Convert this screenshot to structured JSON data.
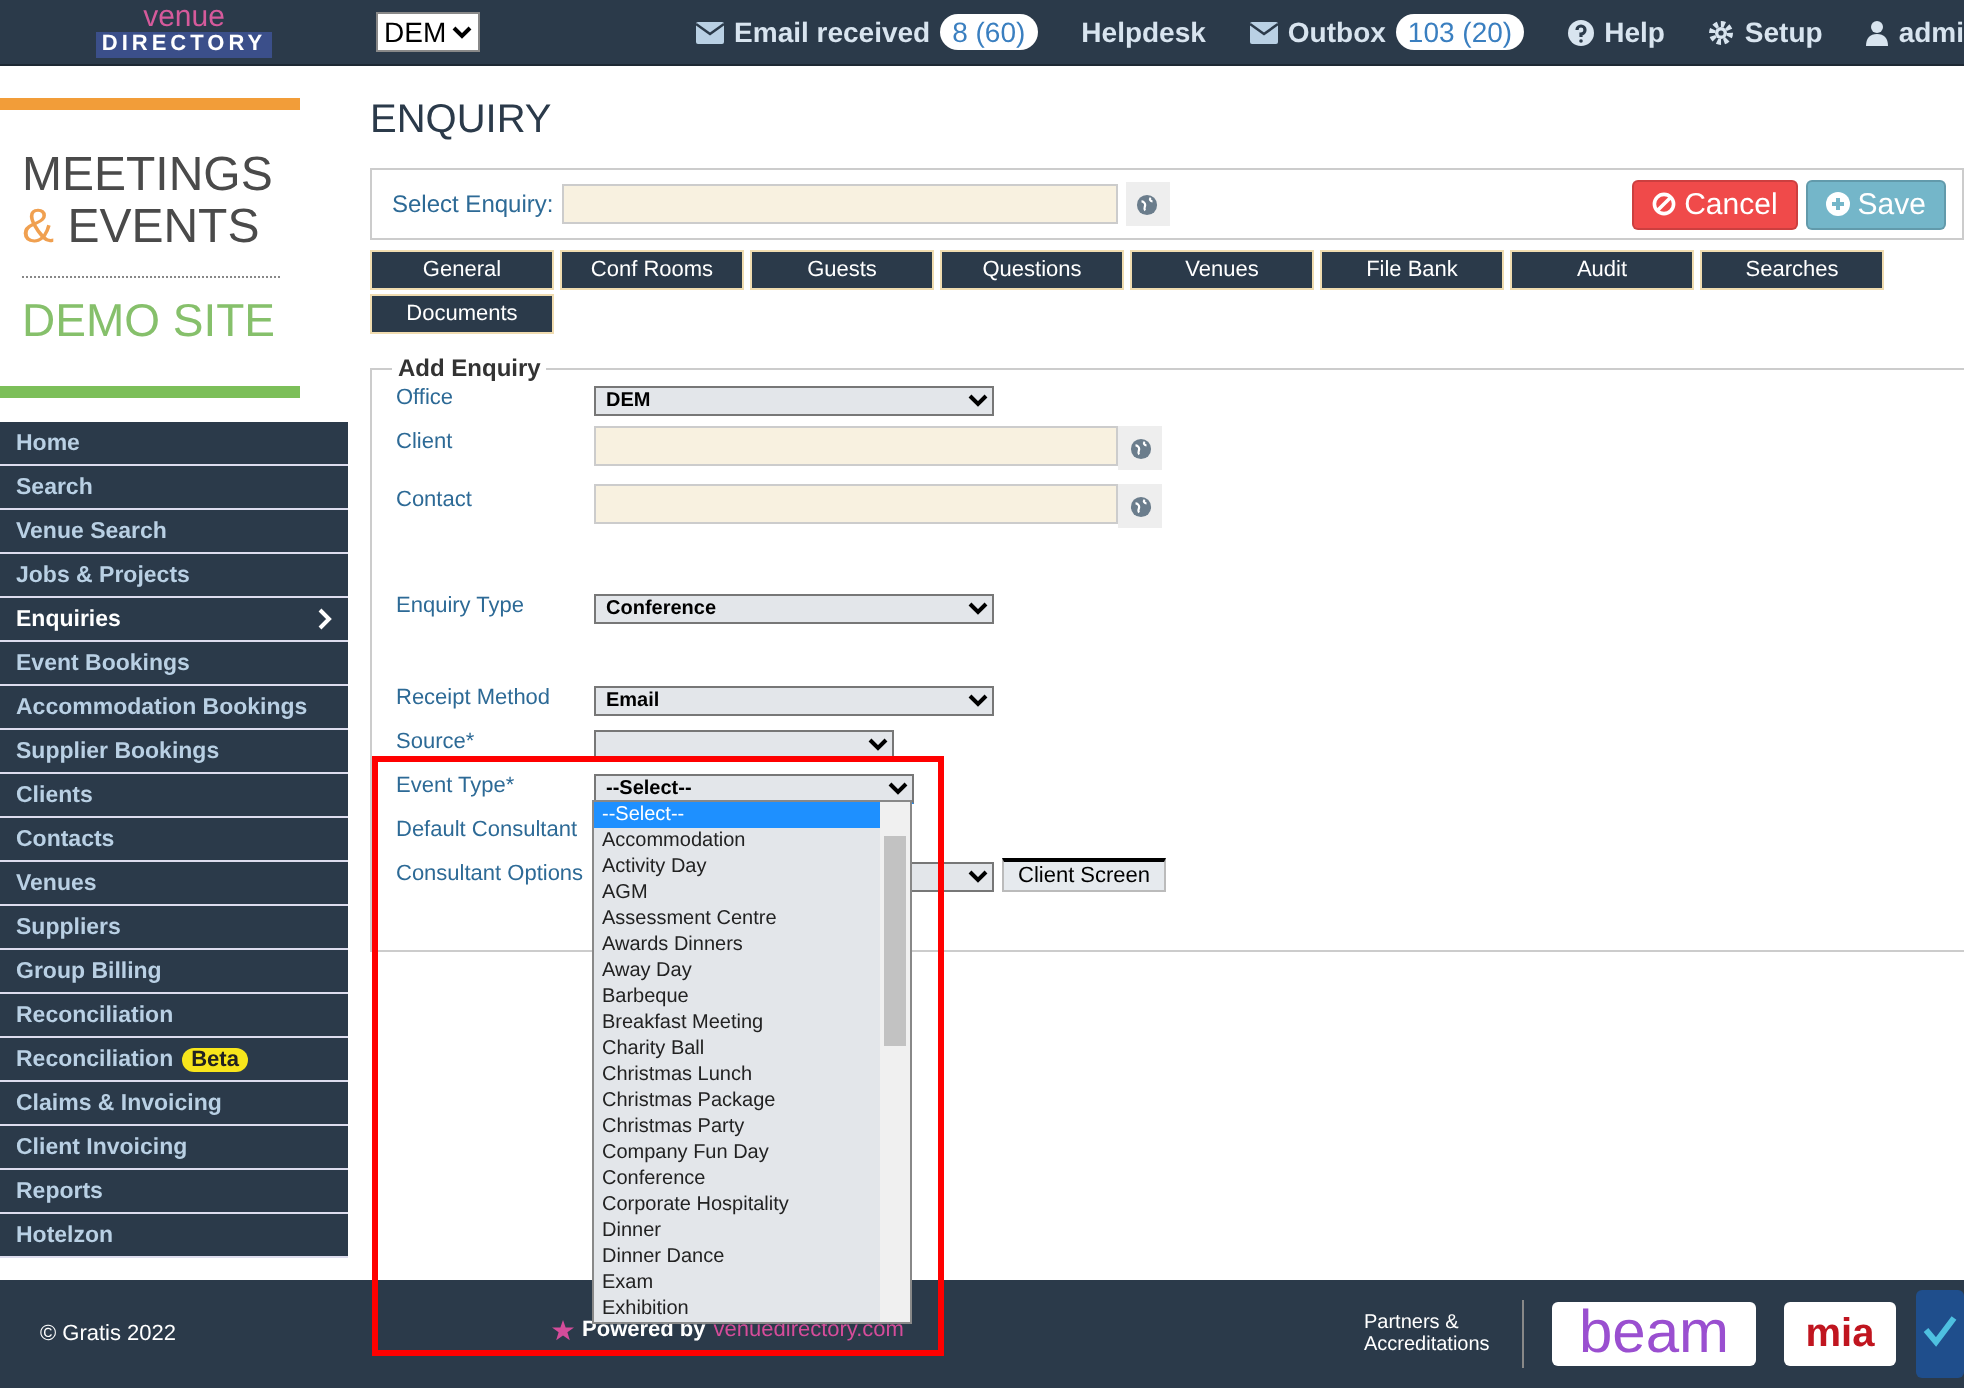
{
  "header": {
    "logo_top": "venue",
    "logo_bottom": "DIRECTORY",
    "office_select": "DEM",
    "links": [
      {
        "kind": "mail",
        "label": "Email received",
        "badge": "8 (60)"
      },
      {
        "kind": "text",
        "label": "Helpdesk"
      },
      {
        "kind": "mail",
        "label": "Outbox",
        "badge": "103 (20)"
      },
      {
        "kind": "help",
        "label": "Help"
      },
      {
        "kind": "gear",
        "label": "Setup"
      },
      {
        "kind": "user",
        "label": "admi"
      }
    ]
  },
  "brand": {
    "line1": "MEETINGS",
    "amp": "&",
    "line2": "EVENTS",
    "site": "DEMO SITE"
  },
  "sidebar": {
    "items": [
      {
        "label": "Home",
        "selected": false
      },
      {
        "label": "Search",
        "selected": false
      },
      {
        "label": "Venue Search",
        "selected": false
      },
      {
        "label": "Jobs & Projects",
        "selected": false
      },
      {
        "label": "Enquiries",
        "selected": true
      },
      {
        "label": "Event Bookings",
        "selected": false
      },
      {
        "label": "Accommodation Bookings",
        "selected": false
      },
      {
        "label": "Supplier Bookings",
        "selected": false
      },
      {
        "label": "Clients",
        "selected": false
      },
      {
        "label": "Contacts",
        "selected": false
      },
      {
        "label": "Venues",
        "selected": false
      },
      {
        "label": "Suppliers",
        "selected": false
      },
      {
        "label": "Group Billing",
        "selected": false
      },
      {
        "label": "Reconciliation",
        "selected": false
      },
      {
        "label": "Reconciliation",
        "badge": "Beta",
        "selected": false
      },
      {
        "label": "Claims & Invoicing",
        "selected": false
      },
      {
        "label": "Client Invoicing",
        "selected": false
      },
      {
        "label": "Reports",
        "selected": false
      },
      {
        "label": "Hotelzon",
        "selected": false
      }
    ]
  },
  "page": {
    "title": "ENQUIRY",
    "select_label": "Select Enquiry:",
    "cancel": "Cancel",
    "save": "Save",
    "tabs": [
      "General",
      "Conf Rooms",
      "Guests",
      "Questions",
      "Venues",
      "File Bank",
      "Audit",
      "Searches",
      "Documents"
    ],
    "form": {
      "legend": "Add Enquiry",
      "rows": [
        {
          "kind": "select",
          "label": "Office",
          "value": "DEM"
        },
        {
          "kind": "lookup",
          "label": "Client"
        },
        {
          "kind": "lookup",
          "label": "Contact"
        },
        {
          "kind": "spacer"
        },
        {
          "kind": "select",
          "label": "Enquiry Type",
          "value": "Conference"
        },
        {
          "kind": "spacer"
        },
        {
          "kind": "select",
          "label": "Receipt Method",
          "value": "Email"
        },
        {
          "kind": "short_select",
          "label": "Source*"
        },
        {
          "kind": "open_select",
          "label": "Event Type*",
          "value": "--Select--"
        },
        {
          "kind": "label",
          "label": "Default Consultant"
        },
        {
          "kind": "select",
          "label": "Consultant Options",
          "button": "Client Screen"
        }
      ]
    }
  },
  "dropdown": {
    "options": [
      {
        "label": "--Select--",
        "selected": true
      },
      {
        "label": "Accommodation",
        "selected": false
      },
      {
        "label": "Activity Day",
        "selected": false
      },
      {
        "label": "AGM",
        "selected": false
      },
      {
        "label": "Assessment Centre",
        "selected": false
      },
      {
        "label": "Awards Dinners",
        "selected": false
      },
      {
        "label": "Away Day",
        "selected": false
      },
      {
        "label": "Barbeque",
        "selected": false
      },
      {
        "label": "Breakfast Meeting",
        "selected": false
      },
      {
        "label": "Charity Ball",
        "selected": false
      },
      {
        "label": "Christmas Lunch",
        "selected": false
      },
      {
        "label": "Christmas Package",
        "selected": false
      },
      {
        "label": "Christmas Party",
        "selected": false
      },
      {
        "label": "Company Fun Day",
        "selected": false
      },
      {
        "label": "Conference",
        "selected": false
      },
      {
        "label": "Corporate Hospitality",
        "selected": false
      },
      {
        "label": "Dinner",
        "selected": false
      },
      {
        "label": "Dinner Dance",
        "selected": false
      },
      {
        "label": "Exam",
        "selected": false
      },
      {
        "label": "Exhibition",
        "selected": false
      }
    ]
  },
  "footer": {
    "copyright": "© Gratis 2022",
    "powered": "Powered by",
    "site": "venuedirectory.com",
    "partners": "Partners & Accreditations",
    "logos": [
      "beam",
      "mia"
    ]
  }
}
